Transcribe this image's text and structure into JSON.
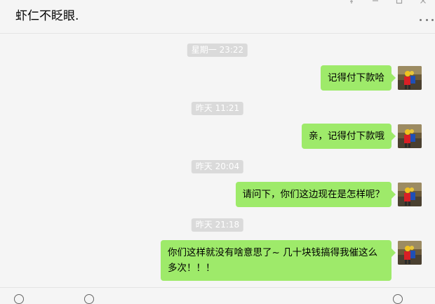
{
  "window": {
    "title": "虾仁不眨眼.",
    "controls": [
      "pin-icon",
      "minimize-icon",
      "maximize-icon",
      "close-icon"
    ],
    "more_label": "..."
  },
  "messages": [
    {
      "timestamp": "星期一 23:22",
      "sender": "me",
      "text": "记得付下款哈"
    },
    {
      "timestamp": "昨天 11:21",
      "sender": "me",
      "text": "亲，记得付下款哦"
    },
    {
      "timestamp": "昨天 20:04",
      "sender": "me",
      "text": "请问下，你们这边现在是怎样呢？"
    },
    {
      "timestamp": "昨天 21:18",
      "sender": "me",
      "text_line1": "你们这样就没有啥意思了~ 几十块钱搞得我催这么",
      "text_line2": "多次！！！"
    }
  ],
  "colors": {
    "bubble_self": "#9eea6a",
    "background": "#f5f5f5",
    "timestamp_bg": "#dadada",
    "timestamp_text": "#ffffff"
  },
  "toolbar": {
    "icons": [
      "emoji-icon",
      "file-icon",
      "screenshot-icon",
      "history-icon"
    ]
  }
}
